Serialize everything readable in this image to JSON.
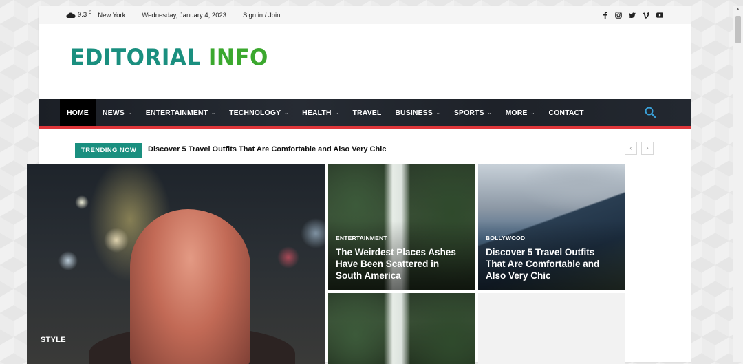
{
  "topbar": {
    "temperature": "9.3",
    "temp_unit": "C",
    "city": "New York",
    "date": "Wednesday, January 4, 2023",
    "signin": "Sign in / Join",
    "social_icons": [
      "facebook-icon",
      "instagram-icon",
      "twitter-icon",
      "vimeo-icon",
      "youtube-icon"
    ]
  },
  "header": {
    "logo_part1": "EDITORIAL",
    "logo_part2": "INFO",
    "logo_colors": {
      "part1": "#1a8f7f",
      "part2": "#3ba82e"
    }
  },
  "nav": {
    "items": [
      {
        "label": "HOME",
        "dropdown": false,
        "active": true
      },
      {
        "label": "NEWS",
        "dropdown": true
      },
      {
        "label": "ENTERTAINMENT",
        "dropdown": true
      },
      {
        "label": "TECHNOLOGY",
        "dropdown": true
      },
      {
        "label": "HEALTH",
        "dropdown": true
      },
      {
        "label": "TRAVEL",
        "dropdown": false
      },
      {
        "label": "BUSINESS",
        "dropdown": true
      },
      {
        "label": "SPORTS",
        "dropdown": true
      },
      {
        "label": "MORE",
        "dropdown": true
      },
      {
        "label": "CONTACT",
        "dropdown": false
      }
    ],
    "accent_line": "#e0363a",
    "search_icon": "search-icon"
  },
  "trending": {
    "badge": "TRENDING NOW",
    "headline": "Discover 5 Travel Outfits That Are Comfortable and Also Very Chic",
    "prev": "‹",
    "next": "›"
  },
  "featured": {
    "big": {
      "category": "STYLE"
    },
    "tiles": [
      {
        "category": "ENTERTAINMENT",
        "title": "The Weirdest Places Ashes Have Been Scattered in South America"
      },
      {
        "category": "BOLLYWOOD",
        "title": "Discover 5 Travel Outfits That Are Comfortable and Also Very Chic"
      }
    ]
  }
}
